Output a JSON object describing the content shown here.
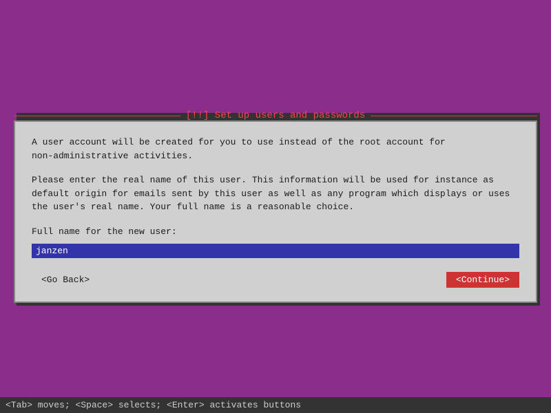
{
  "title": "[!!] Set up users and passwords",
  "dialog": {
    "paragraph1": "A user account will be created for you to use instead of the root account for\nnon-administrative activities.",
    "paragraph2": "Please enter the real name of this user. This information will be used for instance as\ndefault origin for emails sent by this user as well as any program which displays or uses\nthe user's real name. Your full name is a reasonable choice.",
    "label": "Full name for the new user:",
    "input_value": "janzen",
    "input_placeholder": ""
  },
  "buttons": {
    "back_label": "<Go Back>",
    "continue_label": "<Continue>"
  },
  "status_bar": {
    "text": "<Tab> moves; <Space> selects; <Enter> activates buttons"
  }
}
